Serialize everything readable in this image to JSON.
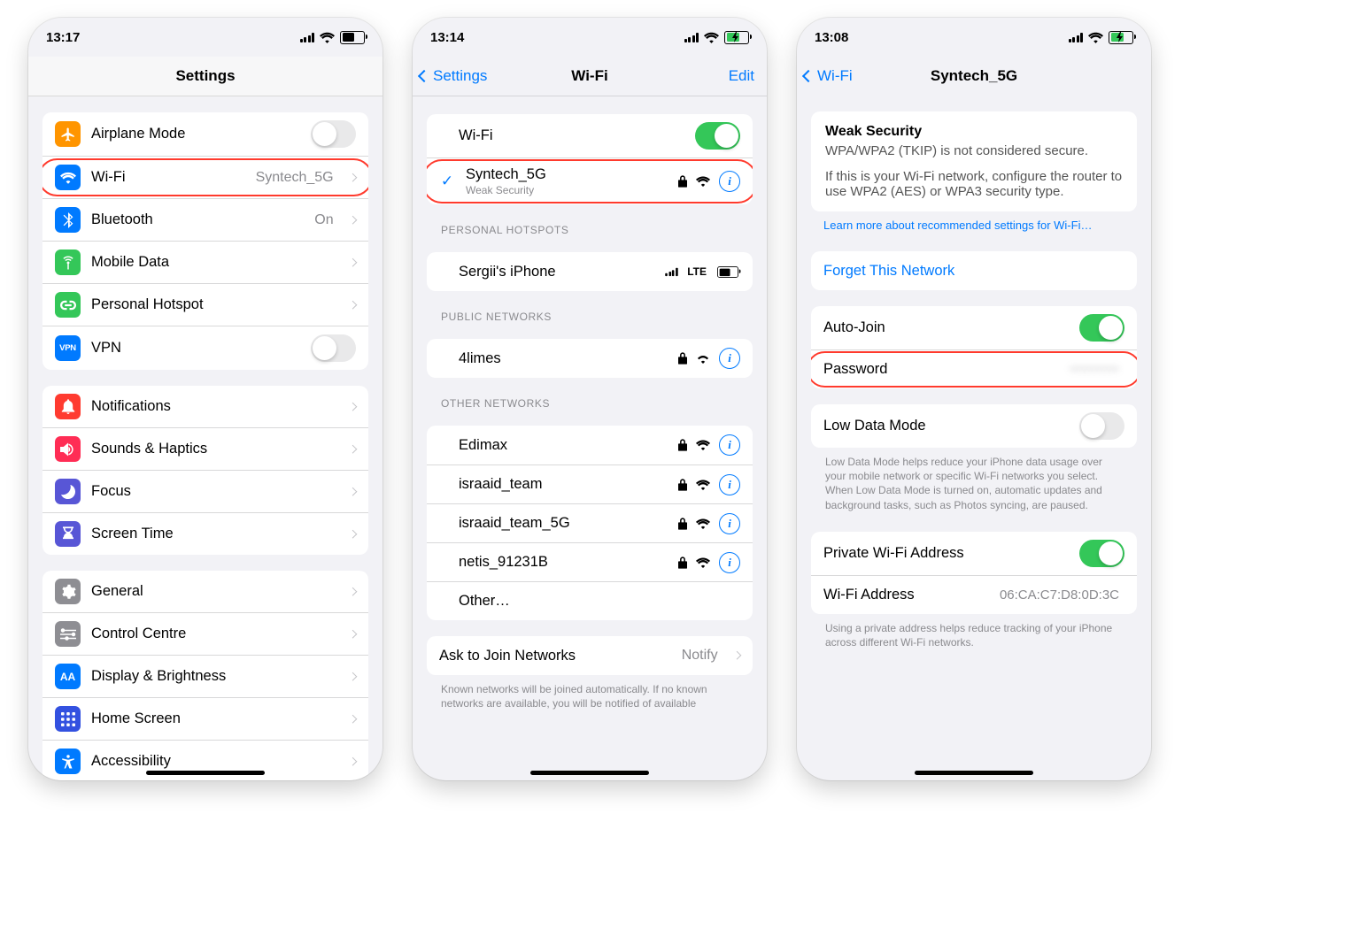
{
  "screens": {
    "settings": {
      "time": "13:17",
      "battery_pct": 50,
      "battery_charging": false,
      "title": "Settings",
      "rows": [
        {
          "icon": "airplane",
          "icon_bg": "#ff9500",
          "label": "Airplane Mode",
          "type": "switch",
          "on": false
        },
        {
          "icon": "wifi",
          "icon_bg": "#007aff",
          "label": "Wi-Fi",
          "value": "Syntech_5G",
          "type": "nav",
          "highlight": true
        },
        {
          "icon": "bluetooth",
          "icon_bg": "#007aff",
          "label": "Bluetooth",
          "value": "On",
          "type": "nav"
        },
        {
          "icon": "antenna",
          "icon_bg": "#34c759",
          "label": "Mobile Data",
          "type": "nav"
        },
        {
          "icon": "link",
          "icon_bg": "#34c759",
          "label": "Personal Hotspot",
          "type": "nav"
        },
        {
          "icon_text": "VPN",
          "icon_bg": "#007aff",
          "label": "VPN",
          "type": "switch",
          "on": false
        }
      ],
      "rows2": [
        {
          "icon": "bell",
          "icon_bg": "#ff3b30",
          "label": "Notifications",
          "type": "nav"
        },
        {
          "icon": "speaker",
          "icon_bg": "#ff2d55",
          "label": "Sounds & Haptics",
          "type": "nav"
        },
        {
          "icon": "moon",
          "icon_bg": "#5856d6",
          "label": "Focus",
          "type": "nav"
        },
        {
          "icon": "hourglass",
          "icon_bg": "#5856d6",
          "label": "Screen Time",
          "type": "nav"
        }
      ],
      "rows3": [
        {
          "icon": "gear",
          "icon_bg": "#8e8e93",
          "label": "General",
          "type": "nav"
        },
        {
          "icon": "sliders",
          "icon_bg": "#8e8e93",
          "label": "Control Centre",
          "type": "nav"
        },
        {
          "icon_text": "AA",
          "icon_bg": "#007aff",
          "label": "Display & Brightness",
          "type": "nav"
        },
        {
          "icon": "grid",
          "icon_bg": "#3351e0",
          "label": "Home Screen",
          "type": "nav"
        },
        {
          "icon": "accessibility",
          "icon_bg": "#007aff",
          "label": "Accessibility",
          "type": "nav"
        }
      ]
    },
    "wifi": {
      "time": "13:14",
      "battery_pct": 60,
      "battery_charging": true,
      "back_label": "Settings",
      "title": "Wi-Fi",
      "right_label": "Edit",
      "toggle_label": "Wi-Fi",
      "toggle_on": true,
      "connected": {
        "name": "Syntech_5G",
        "sub": "Weak Security",
        "highlight": true
      },
      "personal_header": "PERSONAL HOTSPOTS",
      "personal": [
        {
          "name": "Sergii's iPhone",
          "tail": "lte"
        }
      ],
      "public_header": "PUBLIC NETWORKS",
      "public": [
        {
          "name": "4limes"
        }
      ],
      "other_header": "OTHER NETWORKS",
      "other": [
        {
          "name": "Edimax"
        },
        {
          "name": "israaid_team"
        },
        {
          "name": "israaid_team_5G"
        },
        {
          "name": "netis_91231B"
        },
        {
          "name": "Other…",
          "plain": true
        }
      ],
      "ask_label": "Ask to Join Networks",
      "ask_value": "Notify",
      "ask_footer": "Known networks will be joined automatically. If no known networks are available, you will be notified of available"
    },
    "detail": {
      "time": "13:08",
      "battery_pct": 60,
      "battery_charging": true,
      "back_label": "Wi-Fi",
      "title": "Syntech_5G",
      "warning_title": "Weak Security",
      "warning_line1": "WPA/WPA2 (TKIP) is not considered secure.",
      "warning_line2": "If this is your Wi-Fi network, configure the router to use WPA2 (AES) or WPA3 security type.",
      "learn_more": "Learn more about recommended settings for Wi-Fi…",
      "forget": "Forget This Network",
      "autojoin_label": "Auto-Join",
      "autojoin_on": true,
      "password_label": "Password",
      "password_highlight": true,
      "lowdata_label": "Low Data Mode",
      "lowdata_on": false,
      "lowdata_footer": "Low Data Mode helps reduce your iPhone data usage over your mobile network or specific Wi-Fi networks you select. When Low Data Mode is turned on, automatic updates and background tasks, such as Photos syncing, are paused.",
      "private_label": "Private Wi-Fi Address",
      "private_on": true,
      "wifiaddr_label": "Wi-Fi Address",
      "wifiaddr_value": "06:CA:C7:D8:0D:3C",
      "private_footer": "Using a private address helps reduce tracking of your iPhone across different Wi-Fi networks."
    }
  }
}
